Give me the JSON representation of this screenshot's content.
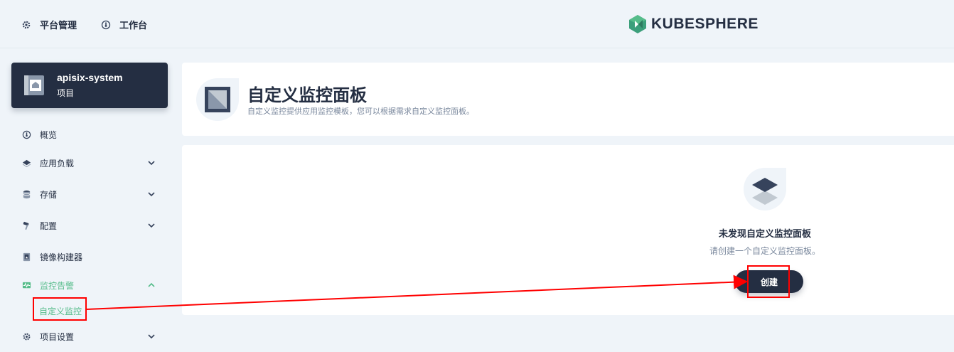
{
  "topbar": {
    "platform_label": "平台管理",
    "workbench_label": "工作台",
    "logo_text": "KUBESPHERE"
  },
  "project": {
    "name": "apisix-system",
    "type": "项目"
  },
  "sidebar": {
    "items": [
      {
        "label": "概览",
        "icon": "dashboard-icon"
      },
      {
        "label": "应用负载",
        "icon": "layers-icon"
      },
      {
        "label": "存储",
        "icon": "database-icon"
      },
      {
        "label": "配置",
        "icon": "hammer-icon"
      },
      {
        "label": "镜像构建器",
        "icon": "image-builder-icon"
      },
      {
        "label": "监控告警",
        "icon": "monitor-icon"
      },
      {
        "label": "项目设置",
        "icon": "gear-icon"
      }
    ],
    "active_sub_item": "自定义监控"
  },
  "header": {
    "title": "自定义监控面板",
    "description": "自定义监控提供应用监控模板，您可以根据需求自定义监控面板。"
  },
  "empty": {
    "title": "未发现自定义监控面板",
    "description": "请创建一个自定义监控面板。",
    "create_label": "创建"
  },
  "colors": {
    "accent": "#55bc8a",
    "dark": "#242e42",
    "annotation": "#ff0000"
  }
}
